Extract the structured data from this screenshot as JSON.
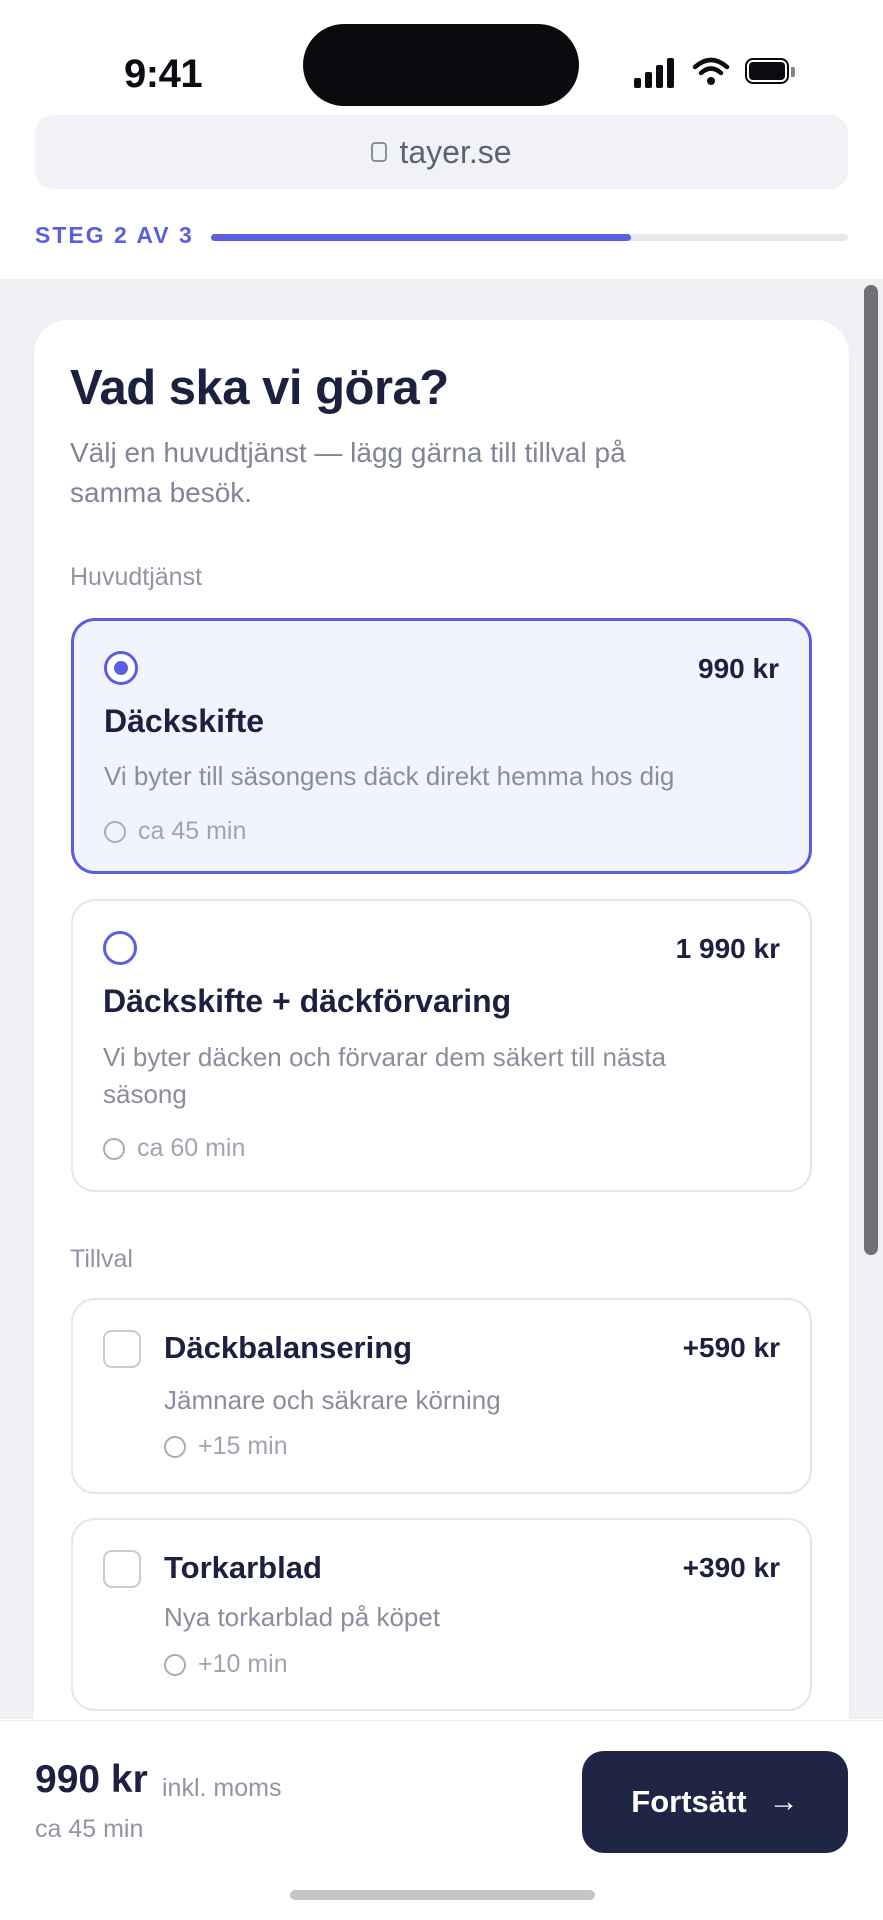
{
  "status_bar": {
    "time": "9:41"
  },
  "browser": {
    "url": "tayer.se"
  },
  "progress": {
    "label": "STEG 2 AV 3",
    "fraction": 0.66
  },
  "page": {
    "title": "Vad ska vi göra?",
    "subtitle": "Välj en huvudtjänst — lägg gärna till tillval på samma besök."
  },
  "main_services": {
    "label": "Huvudtjänst",
    "items": [
      {
        "title": "Däckskifte",
        "price": "990 kr",
        "description": "Vi byter till säsongens däck direkt hemma hos dig",
        "duration": "ca 45 min",
        "selected": true
      },
      {
        "title": "Däckskifte + däckförvaring",
        "price": "1 990 kr",
        "description": "Vi byter däcken och förvarar dem säkert till nästa säsong",
        "duration": "ca 60 min",
        "selected": false
      }
    ]
  },
  "addons": {
    "label": "Tillval",
    "items": [
      {
        "title": "Däckbalansering",
        "price": "+590 kr",
        "description": "Jämnare och säkrare körning",
        "duration": "+15 min",
        "checked": false
      },
      {
        "title": "Torkarblad",
        "price": "+390 kr",
        "description": "Nya torkarblad på köpet",
        "duration": "+10 min",
        "checked": false
      }
    ]
  },
  "summary": {
    "total": "990 kr",
    "vat_note": "inkl. moms",
    "duration": "ca 45 min",
    "continue_label": "Fortsätt"
  },
  "colors": {
    "accent": "#5a5fe0",
    "dark_button": "#1f2544",
    "selected_bg": "#f2f4fd"
  }
}
